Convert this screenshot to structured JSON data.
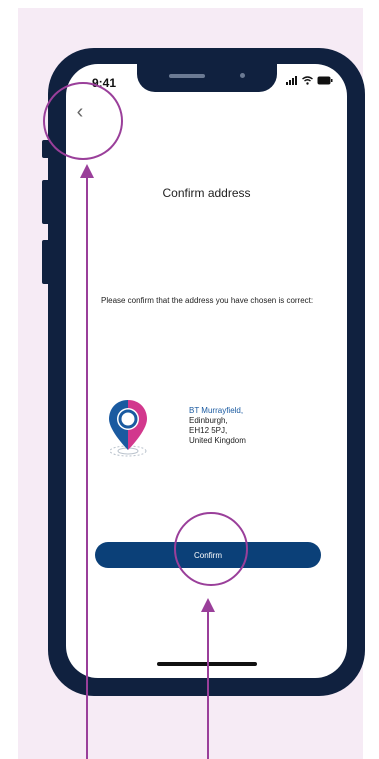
{
  "status_bar": {
    "time": "9:41"
  },
  "nav": {
    "back_glyph": "‹"
  },
  "page": {
    "title": "Confirm address",
    "prompt": "Please confirm that the address you have chosen is correct:"
  },
  "address": {
    "venue": "BT Murrayfield,",
    "line1": "Edinburgh,",
    "line2": "EH12 5PJ,",
    "line3": "United Kingdom"
  },
  "actions": {
    "confirm_label": "Confirm"
  },
  "annotations": {
    "highlight_color": "#9a3f9a"
  },
  "colors": {
    "primary_button": "#0b4078",
    "phone_frame": "#10213f",
    "background_panel": "#f6ebf5",
    "pin_blue": "#1a5aa0",
    "pin_pink": "#d2388d"
  },
  "icons": [
    "back-chevron-icon",
    "signal-icon",
    "wifi-icon",
    "battery-icon",
    "location-pin-icon"
  ]
}
